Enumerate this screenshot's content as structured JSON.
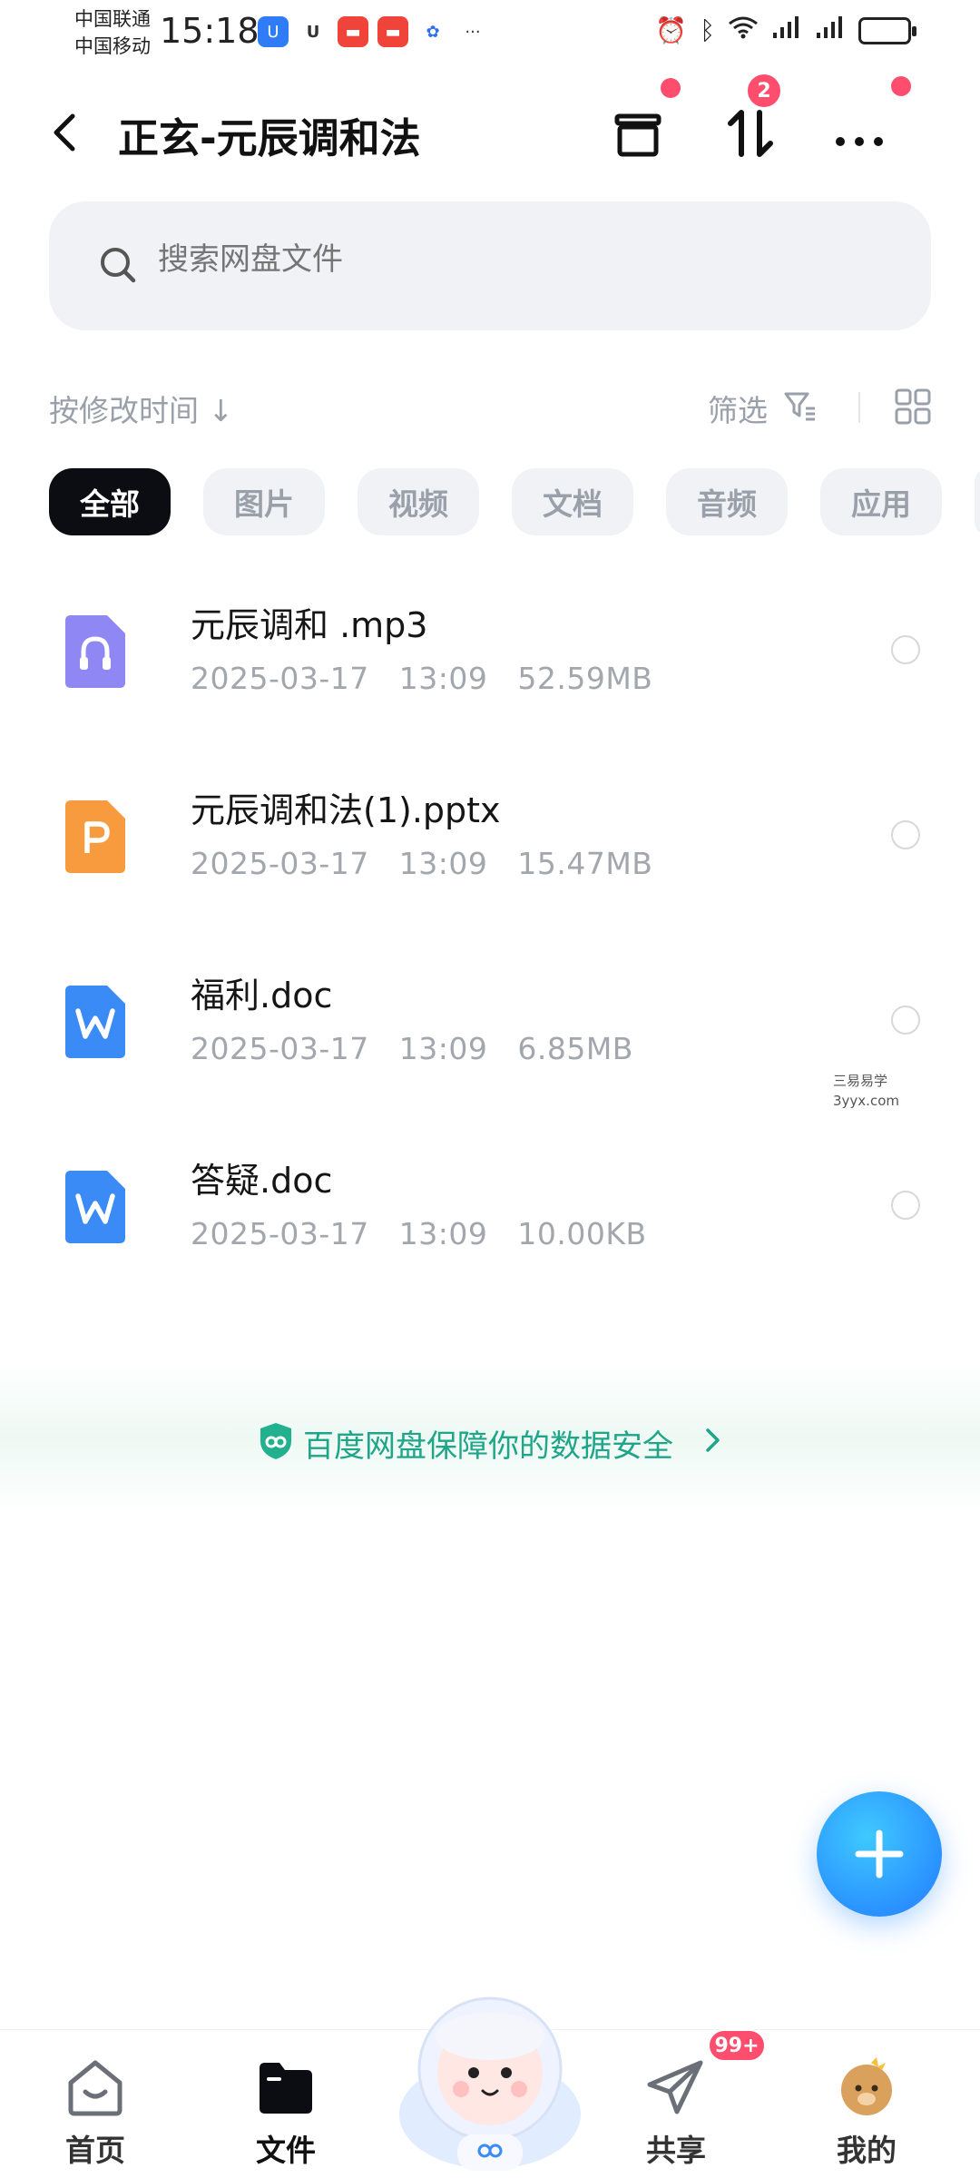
{
  "status_bar": {
    "carrier_1": "中国联通",
    "carrier_2": "中国移动",
    "time": "15:18"
  },
  "header": {
    "title": "正玄-元辰调和法",
    "transfer_badge": "2"
  },
  "search": {
    "placeholder": "搜索网盘文件"
  },
  "sort_bar": {
    "sort_label": "按修改时间",
    "filter_label": "筛选"
  },
  "chips": [
    {
      "label": "全部",
      "active": true
    },
    {
      "label": "图片"
    },
    {
      "label": "视频"
    },
    {
      "label": "文档"
    },
    {
      "label": "音频"
    },
    {
      "label": "应用"
    }
  ],
  "files": [
    {
      "name": "元辰调和 .mp3",
      "date": "2025-03-17",
      "time": "13:09",
      "size": "52.59MB",
      "icon": "audio-file-icon"
    },
    {
      "name": "元辰调和法(1).pptx",
      "date": "2025-03-17",
      "time": "13:09",
      "size": "15.47MB",
      "icon": "ppt-file-icon"
    },
    {
      "name": "福利.doc",
      "date": "2025-03-17",
      "time": "13:09",
      "size": "6.85MB",
      "icon": "word-file-icon"
    },
    {
      "name": "答疑.doc",
      "date": "2025-03-17",
      "time": "13:09",
      "size": "10.00KB",
      "icon": "word-file-icon"
    }
  ],
  "watermark": {
    "line1": "三易易学",
    "line2": "3yyx.com"
  },
  "safety_banner": {
    "text": "百度网盘保障你的数据安全"
  },
  "bottom_nav": {
    "home": "首页",
    "files": "文件",
    "share": "共享",
    "share_badge": "99+",
    "mine": "我的"
  },
  "colors": {
    "accent_blue": "#2a92ff",
    "badge_red": "#ff4d6d",
    "safety_green": "#1fa589"
  }
}
